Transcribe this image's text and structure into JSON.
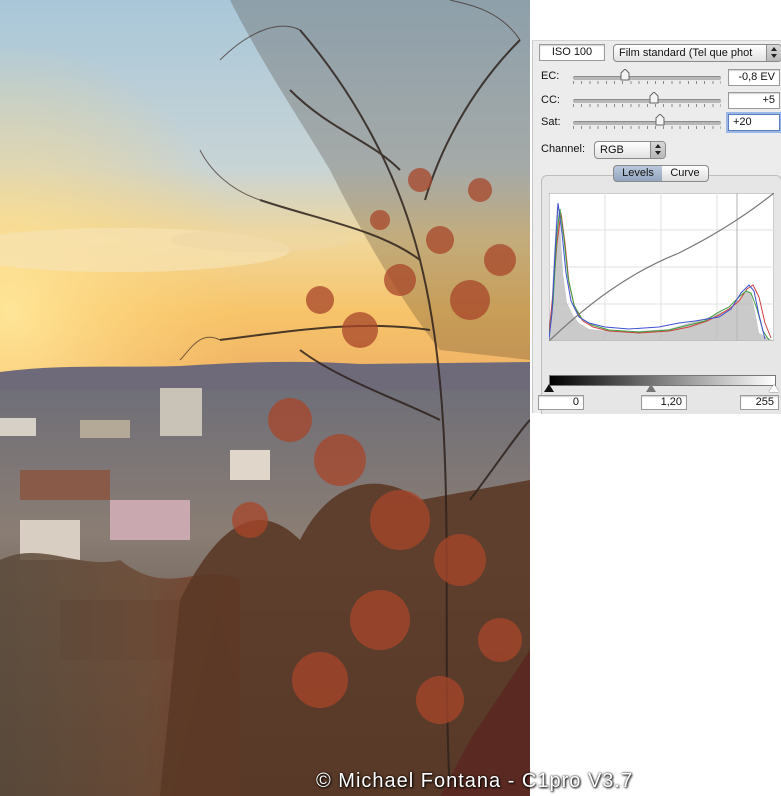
{
  "settings": {
    "iso_value": "ISO 100",
    "film_curve": "Film standard (Tel que phot",
    "ec_label": "EC:",
    "ec_value": "-0,8 EV",
    "ec_level": 0.35,
    "cc_label": "CC:",
    "cc_value": "+5",
    "cc_level": 0.55,
    "sat_label": "Sat:",
    "sat_value": "+20",
    "sat_level": 0.59
  },
  "channel": {
    "label": "Channel:",
    "selected": "RGB"
  },
  "tabs": {
    "levels": "Levels",
    "curve": "Curve"
  },
  "levels": {
    "black": "0",
    "gamma": "1,20",
    "white": "255"
  },
  "credit": "© Michael Fontana - C1pro V3.7",
  "colors": {
    "panel_bg": "#ececec",
    "histogram_red": "#d04040",
    "histogram_green": "#40a040",
    "histogram_blue": "#4050d0"
  }
}
